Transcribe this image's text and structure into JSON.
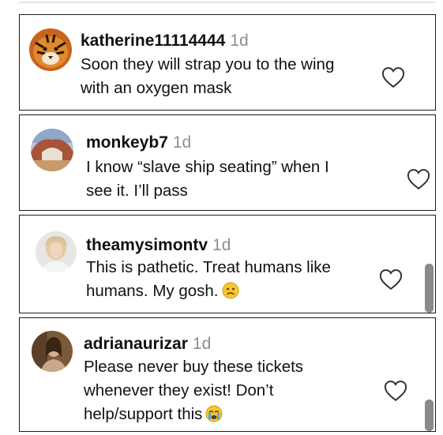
{
  "comments": [
    {
      "username": "katherine11114444",
      "time": "1d",
      "line1": "Soon they will strap you to the wing",
      "line2": "with an oxygen mask",
      "line3": "",
      "avatar": "tiger-avatar"
    },
    {
      "username": "monkeyb7",
      "time": "1d",
      "line1": "I know “slave ship seating” when I",
      "line2": "see it. I’ll pass",
      "line3": "",
      "avatar": "landscape-avatar"
    },
    {
      "username": "theamysimontv",
      "time": "1d",
      "line1": "This is pathetic. Treat humans like",
      "line2": "humans. My gosh.",
      "line3": "",
      "emoji": "sad-face-emoji",
      "avatar": "portrait-avatar"
    },
    {
      "username": "adrianaurizar",
      "time": "1d",
      "line1": "Please never buy these tickets",
      "line2": "whenever they exist! Don’t",
      "line3": "help/support this",
      "emoji": "crying-face-emoji",
      "avatar": "photo-avatar"
    }
  ],
  "icons": {
    "like": "heart-outline-icon"
  },
  "colors": {
    "text": "#111111",
    "timestamp": "#8e8e8e",
    "border": "#1c1c1c",
    "scrollbar": "#8a8a8a"
  }
}
